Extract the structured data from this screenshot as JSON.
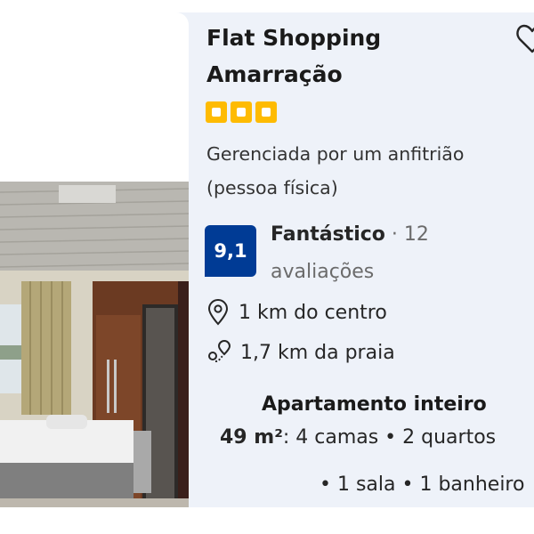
{
  "listing": {
    "name_line1": "Flat Shopping",
    "name_line2": "Amarração",
    "star_rating": 3,
    "host_line1": "Gerenciada por um anfitrião",
    "host_line2": "(pessoa física)",
    "score": "9,1",
    "score_word": "Fantástico",
    "score_separator": "·",
    "review_count": "12",
    "review_label": "avaliações",
    "distance_center": "1 km do centro",
    "distance_beach": "1,7 km da praia",
    "unit_type": "Apartamento inteiro",
    "area": "49 m²",
    "rooms_line1": ": 4 camas • 2 quartos",
    "rooms_line2": "• 1 sala • 1 banheiro"
  },
  "icons": {
    "favorite": "heart-outline-icon",
    "location": "map-pin-icon",
    "beach": "beach-distance-icon",
    "stars": "square-star-rating-icon"
  },
  "colors": {
    "card_background": "#eef2f9",
    "score_badge": "#003b95",
    "stars": "#febb02"
  }
}
